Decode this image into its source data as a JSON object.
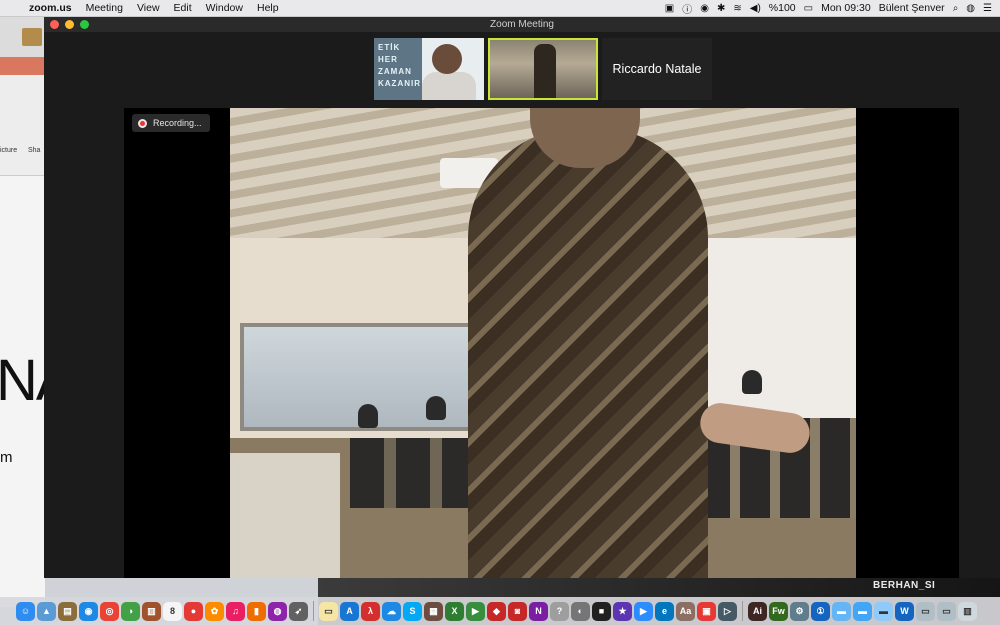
{
  "menubar": {
    "app_name": "zoom.us",
    "menus": [
      "Meeting",
      "View",
      "Edit",
      "Window",
      "Help"
    ],
    "battery": "%100",
    "clock": "Mon 09:30",
    "user": "Bülent Şenver"
  },
  "background_app": {
    "labels": [
      "icture",
      "Sha"
    ],
    "big_text": "NA",
    "small_text": "m"
  },
  "zoom_window": {
    "title": "Zoom Meeting",
    "thumbnails": [
      {
        "banner_text": "ETİK\nHER\nZAMAN\nKAZANIR"
      },
      {
        "active_speaker": true
      },
      {
        "name": "Riccardo Natale"
      }
    ],
    "recording_label": "Recording..."
  },
  "overlay": {
    "label": "BERHAN_SI"
  },
  "dock": {
    "icons": [
      {
        "name": "finder-icon",
        "color": "#2f8cf0",
        "glyph": "☺"
      },
      {
        "name": "preview-icon",
        "color": "#5b9bd5",
        "glyph": "▲"
      },
      {
        "name": "archive-icon",
        "color": "#8a6d3b",
        "glyph": "▤"
      },
      {
        "name": "safari-icon",
        "color": "#1e88e5",
        "glyph": "◉"
      },
      {
        "name": "chrome-icon",
        "color": "#e94335",
        "glyph": "◎"
      },
      {
        "name": "photos-browser-icon",
        "color": "#43a047",
        "glyph": "◑"
      },
      {
        "name": "notebook-icon",
        "color": "#a0522d",
        "glyph": "▥"
      },
      {
        "name": "calendar-icon",
        "color": "#f5f5f5",
        "glyph": "8"
      },
      {
        "name": "notes-icon",
        "color": "#e53935",
        "glyph": "●"
      },
      {
        "name": "photos-icon",
        "color": "#fb8c00",
        "glyph": "✿"
      },
      {
        "name": "music-icon",
        "color": "#e91e63",
        "glyph": "♫"
      },
      {
        "name": "books-icon",
        "color": "#ef6c00",
        "glyph": "▮"
      },
      {
        "name": "podcasts-icon",
        "color": "#8e24aa",
        "glyph": "◍"
      },
      {
        "name": "launchpad-icon",
        "color": "#616161",
        "glyph": "➶"
      },
      {
        "name": "stickies-icon",
        "color": "#f5e6a6",
        "glyph": "▭"
      },
      {
        "name": "app-store-icon",
        "color": "#1976d2",
        "glyph": "A"
      },
      {
        "name": "acrobat-icon",
        "color": "#d32f2f",
        "glyph": "λ"
      },
      {
        "name": "messages-icon",
        "color": "#1e88e5",
        "glyph": "☁"
      },
      {
        "name": "skype-icon",
        "color": "#03a9f4",
        "glyph": "S"
      },
      {
        "name": "files-icon",
        "color": "#6d4c41",
        "glyph": "▦"
      },
      {
        "name": "excel-icon",
        "color": "#2e7d32",
        "glyph": "X"
      },
      {
        "name": "facetime-icon",
        "color": "#388e3c",
        "glyph": "▶"
      },
      {
        "name": "vpn-icon",
        "color": "#c62828",
        "glyph": "◆"
      },
      {
        "name": "screen-icon",
        "color": "#c62828",
        "glyph": "◙"
      },
      {
        "name": "onenote-icon",
        "color": "#7b1fa2",
        "glyph": "N"
      },
      {
        "name": "help-icon",
        "color": "#9e9e9e",
        "glyph": "?"
      },
      {
        "name": "disk-utility-icon",
        "color": "#757575",
        "glyph": "◐"
      },
      {
        "name": "stop-icon",
        "color": "#212121",
        "glyph": "■"
      },
      {
        "name": "imovie-icon",
        "color": "#5e35b1",
        "glyph": "★"
      },
      {
        "name": "zoom-icon",
        "color": "#2d8cff",
        "glyph": "▶"
      },
      {
        "name": "edge-icon",
        "color": "#0277bd",
        "glyph": "e"
      },
      {
        "name": "dictionary-icon",
        "color": "#8d6e63",
        "glyph": "Aa"
      },
      {
        "name": "toolbox-icon",
        "color": "#e53935",
        "glyph": "▣"
      },
      {
        "name": "video-player-icon",
        "color": "#455a64",
        "glyph": "▷"
      },
      {
        "name": "illustrator-icon",
        "color": "#3e2723",
        "glyph": "Ai"
      },
      {
        "name": "fireworks-icon",
        "color": "#33691e",
        "glyph": "Fw"
      },
      {
        "name": "system-prefs-icon",
        "color": "#607d8b",
        "glyph": "⚙"
      },
      {
        "name": "password-icon",
        "color": "#1565c0",
        "glyph": "①"
      },
      {
        "name": "folder-icon",
        "color": "#64b5f6",
        "glyph": "▬"
      },
      {
        "name": "app-folder-icon",
        "color": "#42a5f5",
        "glyph": "▬"
      },
      {
        "name": "downloads-icon",
        "color": "#90caf9",
        "glyph": "▬"
      },
      {
        "name": "word-doc-icon",
        "color": "#1565c0",
        "glyph": "W"
      },
      {
        "name": "screenshot-icon",
        "color": "#b0bec5",
        "glyph": "▭"
      },
      {
        "name": "screenshot2-icon",
        "color": "#b0bec5",
        "glyph": "▭"
      },
      {
        "name": "trash-icon",
        "color": "#cfd8dc",
        "glyph": "▥"
      }
    ]
  }
}
